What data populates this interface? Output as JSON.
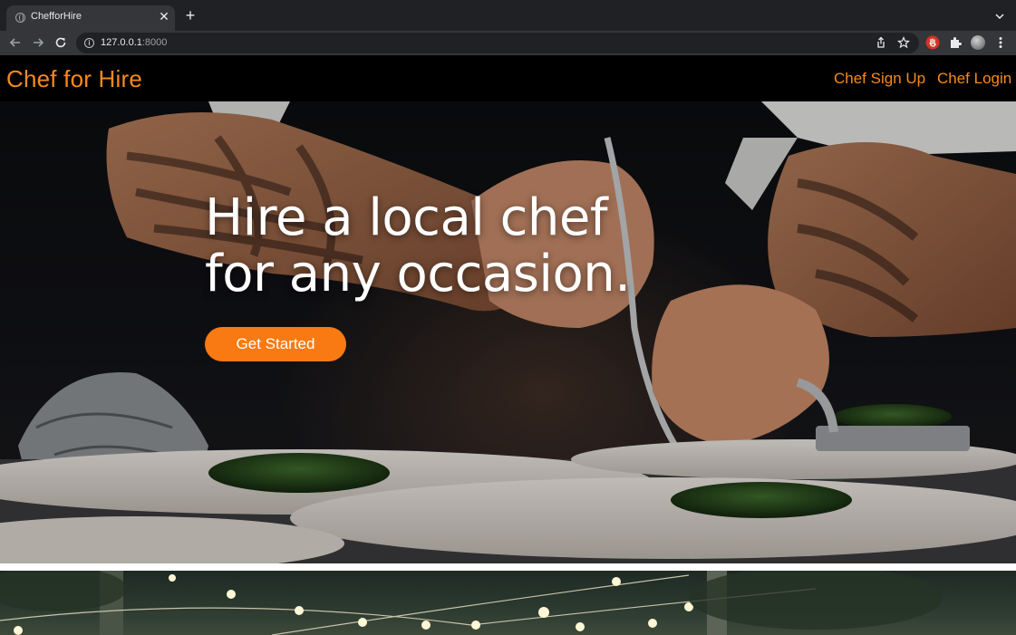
{
  "browser": {
    "tab": {
      "title": "ChefforHire"
    },
    "address": {
      "host": "127.0.0.1",
      "port": ":8000"
    }
  },
  "site": {
    "brand": "Chef for Hire",
    "nav": [
      {
        "label": "Chef Sign Up"
      },
      {
        "label": "Chef Login"
      }
    ]
  },
  "hero": {
    "headline_line1": "Hire a local chef",
    "headline_line2": "for any occasion.",
    "cta_label": "Get Started",
    "image": "chef-plating-food-photo"
  },
  "next_section": {
    "image": "string-lights-outdoor-photo"
  },
  "colors": {
    "accent": "#f58a1f",
    "cta": "#f97a12",
    "nav_background": "#000000"
  }
}
